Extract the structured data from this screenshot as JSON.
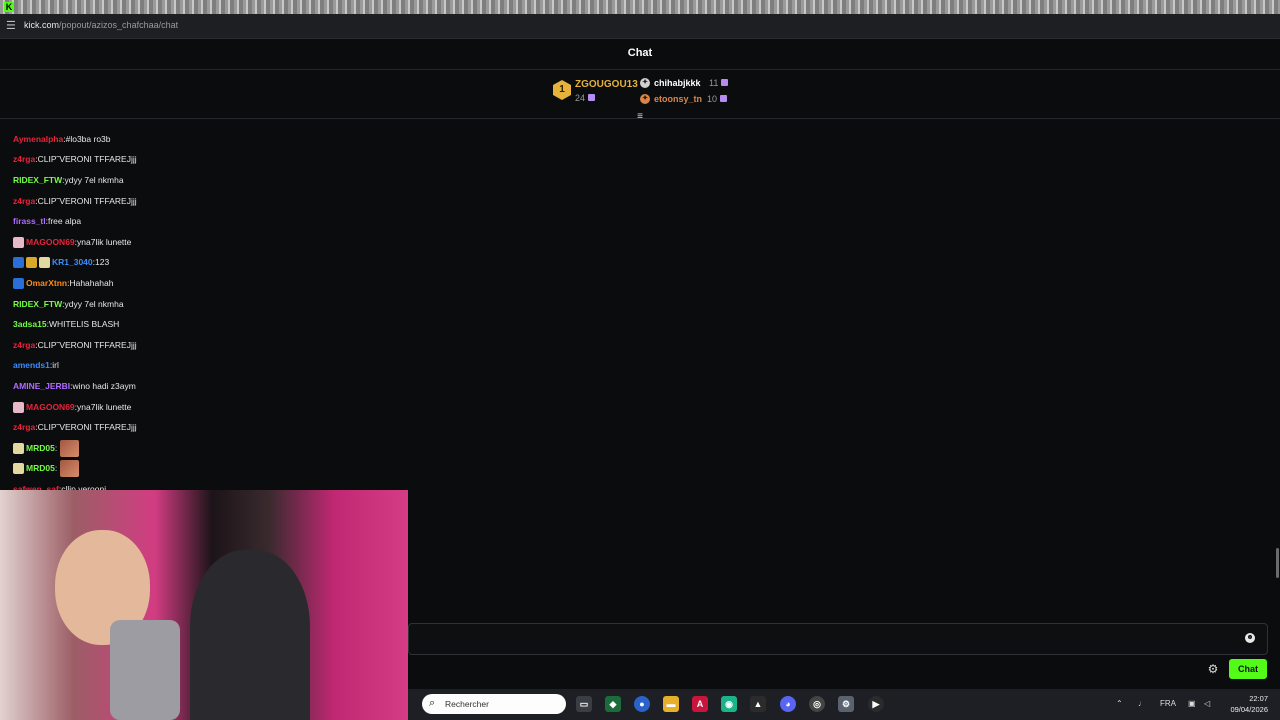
{
  "browser": {
    "url_host": "kick.com",
    "url_path": "/popout/azizos_chafchaa/chat"
  },
  "header": {
    "title": "Chat"
  },
  "leaderboard": {
    "first": {
      "rank": "1",
      "name": "ZGOUGOU13",
      "count": "24"
    },
    "second": {
      "name": "chihabjkkk",
      "count": "11"
    },
    "third": {
      "name": "etoonsy_tn",
      "count": "10"
    }
  },
  "messages": [
    {
      "user": "Aymenalpha",
      "text": "#lo3ba ro3b",
      "color": "#e8243c",
      "badges": []
    },
    {
      "user": "z4rga",
      "text": "CLIP˜VERONI TFFAREJjjj",
      "color": "#e8243c",
      "badges": []
    },
    {
      "user": "RIDEX_FTW",
      "text": "ydyy 7el nkmha",
      "color": "#75fd46",
      "badges": []
    },
    {
      "user": "z4rga",
      "text": "CLIP˜VERONI TFFAREJjjj",
      "color": "#e8243c",
      "badges": []
    },
    {
      "user": "firass_tl",
      "text": "free alpa",
      "color": "#b06cff",
      "badges": []
    },
    {
      "user": "MAGOON69",
      "text": "yna7lik lunette",
      "color": "#e8243c",
      "badges": [
        "gift"
      ]
    },
    {
      "user": "KR1_3040",
      "text": "123",
      "color": "#3c8cff",
      "badges": [
        "vip",
        "crown",
        "og"
      ]
    },
    {
      "user": "OmarXtnn",
      "text": "Hahahahah",
      "color": "#ff8c1a",
      "badges": [
        "vip"
      ]
    },
    {
      "user": "RIDEX_FTW",
      "text": "ydyy 7el nkmha",
      "color": "#75fd46",
      "badges": []
    },
    {
      "user": "3adsa15",
      "text": "WHITELIS BLASH",
      "color": "#75fd46",
      "badges": []
    },
    {
      "user": "z4rga",
      "text": "CLIP˜VERONI TFFAREJjjj",
      "color": "#e8243c",
      "badges": []
    },
    {
      "user": "amends1",
      "text": "irl",
      "color": "#3c8cff",
      "badges": []
    },
    {
      "user": "AMINE_JERBI",
      "text": "wino hadi z3aym",
      "color": "#b06cff",
      "badges": []
    },
    {
      "user": "MAGOON69",
      "text": "yna7lik lunette",
      "color": "#e8243c",
      "badges": [
        "gift"
      ]
    },
    {
      "user": "z4rga",
      "text": "CLIP˜VERONI TFFAREJjjj",
      "color": "#e8243c",
      "badges": []
    },
    {
      "user": "MRD05",
      "text": "",
      "color": "#75fd46",
      "badges": [
        "og"
      ],
      "emote": true
    },
    {
      "user": "MRD05",
      "text": "",
      "color": "#75fd46",
      "badges": [
        "og"
      ],
      "emote": true
    },
    {
      "user": "safwen_saf",
      "text": "cllip verooni",
      "color": "#e8243c",
      "badges": []
    }
  ],
  "input": {
    "send_label": "Chat"
  },
  "taskbar": {
    "search_placeholder": "Rechercher",
    "lang": "FRA",
    "time": "22:07",
    "date": "09/04/2026"
  },
  "colors": {
    "accent": "#53fc18",
    "gold": "#e6b23c",
    "bronze": "#d9864a"
  }
}
